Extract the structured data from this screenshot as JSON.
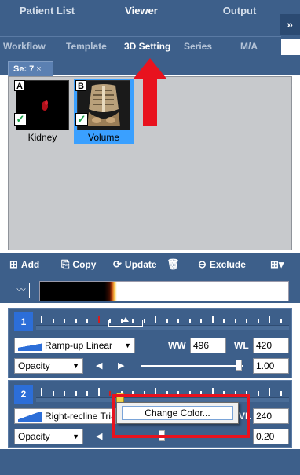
{
  "top_tabs": [
    {
      "label": "Patient List"
    },
    {
      "label": "Viewer"
    },
    {
      "label": "Output"
    }
  ],
  "collapse_label": "»",
  "sub_tabs": [
    {
      "label": "Workflow"
    },
    {
      "label": "Template"
    },
    {
      "label": "3D Setting"
    },
    {
      "label": "Series"
    },
    {
      "label": "M/A"
    }
  ],
  "series_tab": {
    "label": "Se: 7",
    "close": "×"
  },
  "thumbnails": [
    {
      "letter": "A",
      "caption": "Kidney",
      "checked": true
    },
    {
      "letter": "B",
      "caption": "Volume",
      "checked": true,
      "selected": true
    }
  ],
  "toolbar": {
    "add": "Add",
    "copy": "Copy",
    "update": "Update",
    "exclude": "Exclude"
  },
  "panel1": {
    "index": "1",
    "curve": "Ramp-up Linear",
    "ww_label": "WW",
    "ww_value": "496",
    "wl_label": "WL",
    "wl_value": "420",
    "mode": "Opacity",
    "opacity_value": "1.00"
  },
  "panel2": {
    "index": "2",
    "curve": "Right-recline Triangle",
    "curve_visible": "Right-recline Triar",
    "wl_label_partial": "VL",
    "wl_value": "240",
    "mode": "Opacity",
    "opacity_value": "0.20"
  },
  "popup": {
    "item": "Change Color..."
  },
  "colors": {
    "bar_bg": "#3d5f8a",
    "accent": "#2c6ed8",
    "annotation": "#e8121e",
    "selected_thumb": "#3aa0ff"
  }
}
